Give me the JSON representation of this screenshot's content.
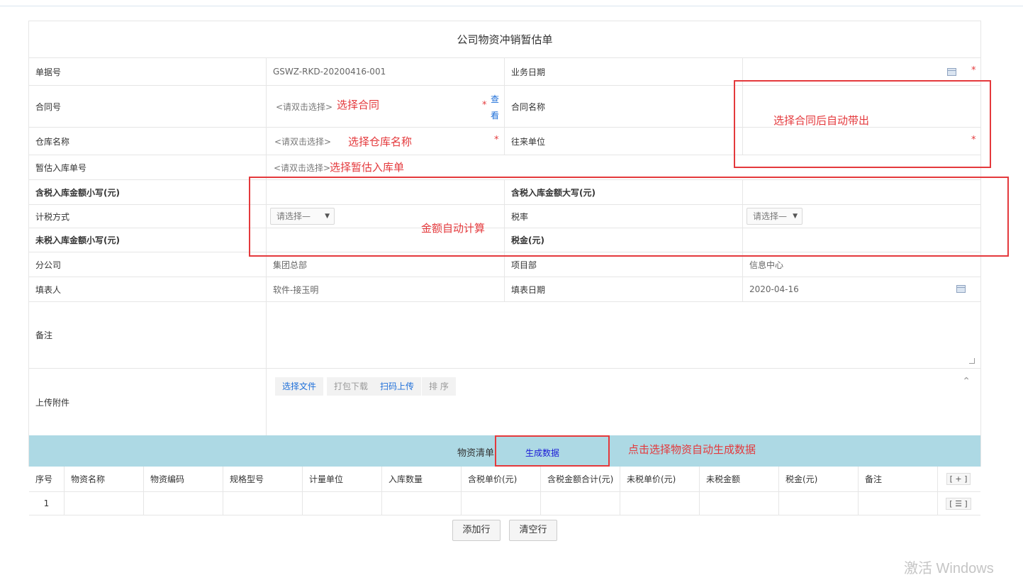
{
  "form": {
    "title": "公司物资冲销暂估单",
    "doc_no_label": "单据号",
    "doc_no_value": "GSWZ-RKD-20200416-001",
    "biz_date_label": "业务日期",
    "contract_no_label": "合同号",
    "contract_no_placeholder": "<请双击选择>",
    "view_link": "查看",
    "contract_name_label": "合同名称",
    "warehouse_label": "仓库名称",
    "warehouse_placeholder": "<请双击选择>",
    "partner_label": "往来单位",
    "temp_no_label": "暂估入库单号",
    "temp_no_placeholder": "<请双击选择>",
    "tax_inc_small_label": "含税入库金额小写(元)",
    "tax_inc_big_label": "含税入库金额大写(元)",
    "tax_method_label": "计税方式",
    "tax_method_select": "请选择—",
    "tax_rate_label": "税率",
    "tax_rate_select": "请选择—",
    "tax_exc_small_label": "未税入库金额小写(元)",
    "tax_amount_label": "税金(元)",
    "branch_label": "分公司",
    "branch_value": "集团总部",
    "project_label": "项目部",
    "project_value": "信息中心",
    "filler_label": "填表人",
    "filler_value": "软件-接玉明",
    "fill_date_label": "填表日期",
    "fill_date_value": "2020-04-16",
    "remark_label": "备注",
    "attach_label": "上传附件",
    "attach_buttons": {
      "select_file": "选择文件",
      "pack_download": "打包下载",
      "scan_upload": "扫码上传",
      "sort": "排 序"
    },
    "required_mark": "*",
    "collapse_glyph": "⌃"
  },
  "grid": {
    "title": "物资清单",
    "generate_link": "生成数据",
    "columns": [
      "序号",
      "物资名称",
      "物资编码",
      "规格型号",
      "计量单位",
      "入库数量",
      "含税单价(元)",
      "含税金额合计(元)",
      "未税单价(元)",
      "未税金额",
      "税金(元)",
      "备注"
    ],
    "add_col_btn": "[ + ]",
    "row_menu_btn": "[ ☰ ]",
    "rows": [
      {
        "index": "1"
      }
    ],
    "add_row": "添加行",
    "clear_rows": "清空行"
  },
  "annotations": {
    "select_contract": "选择合同",
    "auto_from_contract": "选择合同后自动带出",
    "select_warehouse": "选择仓库名称",
    "select_temp": "选择暂估入库单",
    "auto_calc": "金额自动计算",
    "auto_generate": "点击选择物资自动生成数据"
  },
  "watermark": "激活 Windows",
  "colors": {
    "required": "#e4393c",
    "annotation": "#e4393c",
    "link": "#1e6fd9",
    "grid_header": "#add9e4"
  }
}
